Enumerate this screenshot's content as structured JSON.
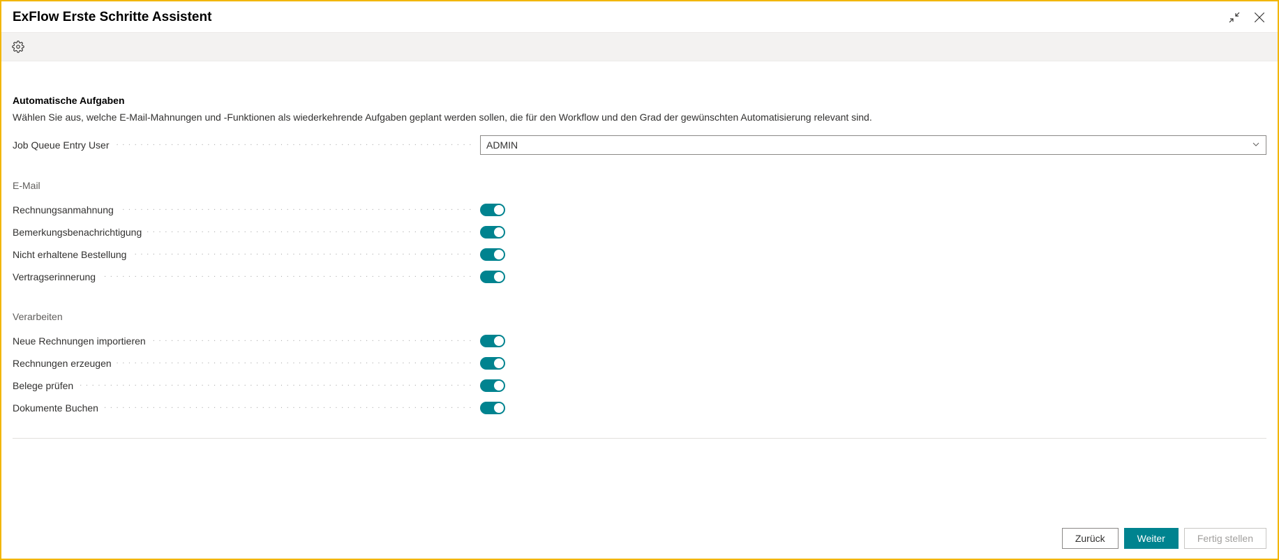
{
  "window_title": "ExFlow Erste Schritte Assistent",
  "section": {
    "title": "Automatische Aufgaben",
    "description": "Wählen Sie aus, welche E-Mail-Mahnungen und -Funktionen als wiederkehrende Aufgaben geplant werden sollen, die für den Workflow und den Grad der gewünschten Automatisierung relevant sind."
  },
  "job_queue": {
    "label": "Job Queue Entry User",
    "value": "ADMIN"
  },
  "groups": {
    "email_heading": "E-Mail",
    "process_heading": "Verarbeiten"
  },
  "toggles": {
    "email": [
      {
        "label": "Rechnungsanmahnung",
        "on": true
      },
      {
        "label": "Bemerkungsbenachrichtigung",
        "on": true
      },
      {
        "label": "Nicht erhaltene Bestellung",
        "on": true
      },
      {
        "label": "Vertragserinnerung",
        "on": true
      }
    ],
    "process": [
      {
        "label": "Neue Rechnungen importieren",
        "on": true
      },
      {
        "label": "Rechnungen erzeugen",
        "on": true
      },
      {
        "label": "Belege prüfen",
        "on": true
      },
      {
        "label": "Dokumente Buchen",
        "on": true
      }
    ]
  },
  "footer": {
    "back": "Zurück",
    "next": "Weiter",
    "finish": "Fertig stellen"
  }
}
